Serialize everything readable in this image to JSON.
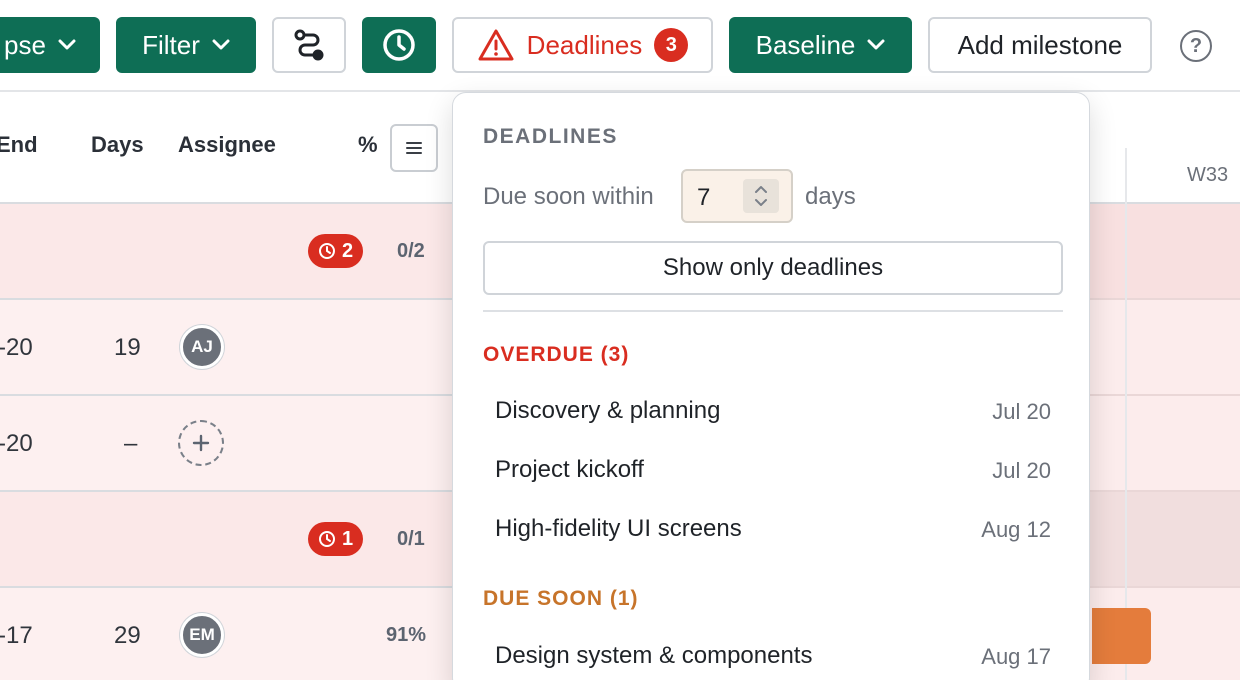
{
  "toolbar": {
    "collapse_label": "pse",
    "filter_label": "Filter",
    "deadlines_label": "Deadlines",
    "deadlines_count": "3",
    "baseline_label": "Baseline",
    "add_milestone_label": "Add milestone",
    "help_symbol": "?"
  },
  "table": {
    "columns": {
      "end": "End",
      "days": "Days",
      "assignee": "Assignee",
      "percent": "%"
    },
    "rows": [
      {
        "type": "group",
        "overdue_count": "2",
        "progress": "0/2"
      },
      {
        "type": "task",
        "end": "-20",
        "days": "19",
        "assignee_initials": "AJ"
      },
      {
        "type": "task",
        "end": "-20",
        "days": "–",
        "assignee": "add"
      },
      {
        "type": "group",
        "overdue_count": "1",
        "progress": "0/1"
      },
      {
        "type": "task",
        "end": "-17",
        "days": "29",
        "assignee_initials": "EM",
        "percent": "91%"
      }
    ]
  },
  "gantt": {
    "week_label": "W33"
  },
  "deadlines_popover": {
    "title": "DEADLINES",
    "due_soon_prefix": "Due soon within",
    "due_soon_value": "7",
    "due_soon_unit": "days",
    "show_only_label": "Show only deadlines",
    "overdue_heading": "OVERDUE (3)",
    "overdue": [
      {
        "name": "Discovery & planning",
        "date": "Jul 20"
      },
      {
        "name": "Project kickoff",
        "date": "Jul 20"
      },
      {
        "name": "High-fidelity UI screens",
        "date": "Aug 12"
      }
    ],
    "due_soon_heading": "DUE SOON (1)",
    "due_soon": [
      {
        "name": "Design system & components",
        "date": "Aug 17"
      }
    ]
  },
  "colors": {
    "brand_green": "#0e6e55",
    "overdue_red": "#d92d20",
    "due_soon_orange": "#c7742a",
    "group_row_bg": "#fbe8e8",
    "task_bar": "#e47c3c"
  }
}
